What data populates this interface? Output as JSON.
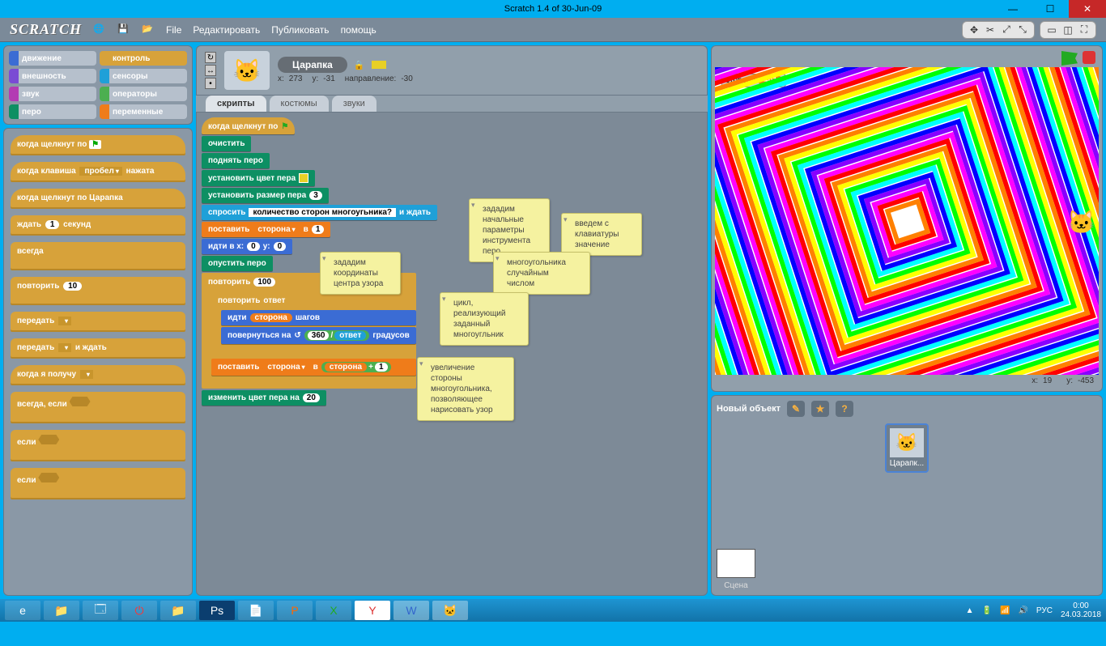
{
  "window": {
    "title": "Scratch 1.4 of 30-Jun-09"
  },
  "menu": {
    "file": "File",
    "edit": "Редактировать",
    "share": "Публиковать",
    "help": "помощь"
  },
  "categories": [
    {
      "name": "движение",
      "color": "#3b6cd4"
    },
    {
      "name": "контроль",
      "color": "#d7a23a",
      "selected": true
    },
    {
      "name": "внешность",
      "color": "#7a4bd4"
    },
    {
      "name": "сенсоры",
      "color": "#1fa0d8"
    },
    {
      "name": "звук",
      "color": "#b33bb3"
    },
    {
      "name": "операторы",
      "color": "#4caf50"
    },
    {
      "name": "перо",
      "color": "#0d8f63"
    },
    {
      "name": "переменные",
      "color": "#ef7c1a"
    }
  ],
  "palette_blocks": {
    "when_flag": "когда щелкнут по",
    "when_key": "когда клавиша",
    "when_key_opt": "пробел",
    "when_key_suffix": "нажата",
    "when_sprite": "когда щелкнут по  Царапка",
    "wait": "ждать",
    "wait_val": "1",
    "wait_suffix": "секунд",
    "forever": "всегда",
    "repeat": "повторить",
    "repeat_val": "10",
    "broadcast1": "передать",
    "broadcast2": "передать",
    "broadcast2_suffix": "и ждать",
    "when_receive": "когда я получу",
    "forever_if": "всегда, если",
    "if1": "если",
    "if2": "если"
  },
  "sprite": {
    "name": "Царапка",
    "x_label": "x:",
    "x": "273",
    "y_label": "y:",
    "y": "-31",
    "dir_label": "направление:",
    "dir": "-30"
  },
  "tabs": {
    "scripts": "скрипты",
    "costumes": "костюмы",
    "sounds": "звуки"
  },
  "script": {
    "when_flag": "когда щелкнут по",
    "clear": "очистить",
    "pen_up": "поднять перо",
    "set_pen_color": "установить цвет пера",
    "set_pen_size": "установить размер пера",
    "pen_size_val": "3",
    "ask": "спросить",
    "ask_val": "количество сторон многоугьника?",
    "ask_suffix": "и ждать",
    "set_var": "поставить",
    "set_var_var": "сторона",
    "set_var_in": "в",
    "set_var_val": "1",
    "go_to": "идти в x:",
    "go_x": "0",
    "go_y_label": "y:",
    "go_y": "0",
    "pen_down": "опустить перо",
    "repeat": "повторить",
    "repeat_val": "100",
    "inner_repeat": "повторить",
    "inner_repeat_arg": "ответ",
    "move": "идти",
    "move_var": "сторона",
    "move_suffix": "шагов",
    "turn": "повернуться на",
    "turn_a": "360",
    "turn_slash": "/",
    "turn_b": "ответ",
    "turn_suffix": "градусов",
    "set_var2": "поставить",
    "set_var2_var": "сторона",
    "set_var2_in": "в",
    "set_var2_expr_a": "сторона",
    "set_var2_expr_plus": "+",
    "set_var2_expr_b": "1",
    "change_pen": "изменить цвет пера на",
    "change_pen_val": "20"
  },
  "comments": {
    "c1": "зададим\nначальные\nпараметры\nинструмента\nперо",
    "c2": "введем с\nклавиатуры\nзначение",
    "c3": "многоугольника\nслучайным\nчислом",
    "c4": "зададим\nкоординаты\nцентра узора",
    "c5": "цикл,\nреализующий\nзаданный\nмногоугльник",
    "c6": "увеличение\nстороны\nмногоугольника,\nпозволяющее\nнарисовать узор"
  },
  "stage": {
    "var_name": "сторона",
    "var_value": "401",
    "coord_x_label": "x:",
    "coord_x": "19",
    "coord_y_label": "y:",
    "coord_y": "-453"
  },
  "sprites_panel": {
    "title": "Новый объект",
    "stage_label": "Сцена",
    "sprite1": "Царапк..."
  },
  "taskbar": {
    "lang": "РУС",
    "time": "0:00",
    "date": "24.03.2018"
  }
}
